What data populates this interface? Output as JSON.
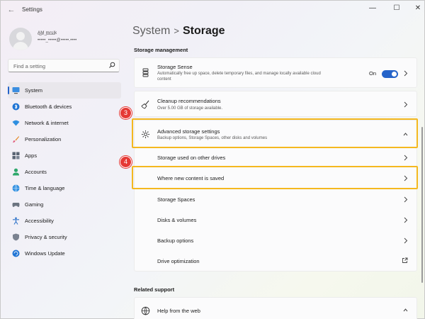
{
  "window": {
    "title": "Settings",
    "controls": {
      "minimize": "—",
      "maximize": "☐",
      "close": "✕"
    },
    "back_glyph": "←"
  },
  "user": {
    "name": "A̲̲M̲ ̲m̲r̲s̲l̲k",
    "email": "•••••_•••••@•••••.••••"
  },
  "search": {
    "placeholder": "Find a setting"
  },
  "nav": {
    "items": [
      {
        "label": "System",
        "icon": "monitor-icon",
        "active": true
      },
      {
        "label": "Bluetooth & devices",
        "icon": "bluetooth-icon"
      },
      {
        "label": "Network & internet",
        "icon": "wifi-icon"
      },
      {
        "label": "Personalization",
        "icon": "brush-icon"
      },
      {
        "label": "Apps",
        "icon": "apps-icon"
      },
      {
        "label": "Accounts",
        "icon": "person-icon"
      },
      {
        "label": "Time & language",
        "icon": "globe-clock-icon"
      },
      {
        "label": "Gaming",
        "icon": "gamepad-icon"
      },
      {
        "label": "Accessibility",
        "icon": "accessibility-icon"
      },
      {
        "label": "Privacy & security",
        "icon": "shield-icon"
      },
      {
        "label": "Windows Update",
        "icon": "update-icon"
      }
    ]
  },
  "breadcrumb": {
    "parent": "System",
    "separator": ">",
    "current": "Storage"
  },
  "storage_management": {
    "heading": "Storage management",
    "storage_sense": {
      "title": "Storage Sense",
      "desc": "Automatically free up space, delete temporary files, and manage locally available cloud content",
      "toggle_label": "On",
      "toggle_on": true
    },
    "cleanup": {
      "title": "Cleanup recommendations",
      "desc": "Over 5.00 GB of storage available."
    },
    "advanced": {
      "title": "Advanced storage settings",
      "desc": "Backup options, Storage Spaces, other disks and volumes",
      "sub_items": [
        "Storage used on other drives",
        "Where new content is saved",
        "Storage Spaces",
        "Disks & volumes",
        "Backup options",
        "Drive optimization"
      ]
    }
  },
  "related_support": {
    "heading": "Related support",
    "help": {
      "title": "Help from the web"
    }
  },
  "annotations": {
    "step_3": "3",
    "step_4": "4"
  },
  "colors": {
    "accent": "#2563c9",
    "highlight": "#f4b81f",
    "badge": "#e53935"
  }
}
